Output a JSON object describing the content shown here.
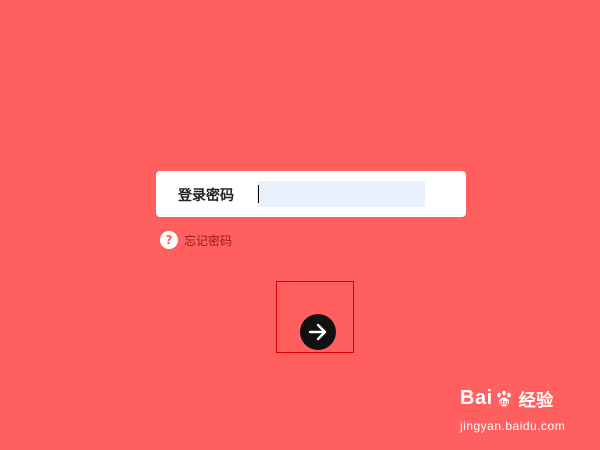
{
  "login": {
    "label": "登录密码",
    "password_value": ""
  },
  "forgot": {
    "icon_glyph": "?",
    "label": "忘记密码"
  },
  "submit": {
    "icon": "arrow-right-icon"
  },
  "watermark": {
    "brand_left": "Bai",
    "brand_right": "经验",
    "domain": "jingyan.baidu.com"
  },
  "colors": {
    "background": "#ff5f5f",
    "input_fill": "#e9f1fd",
    "highlight_border": "#e00000",
    "submit_button": "#111111"
  }
}
